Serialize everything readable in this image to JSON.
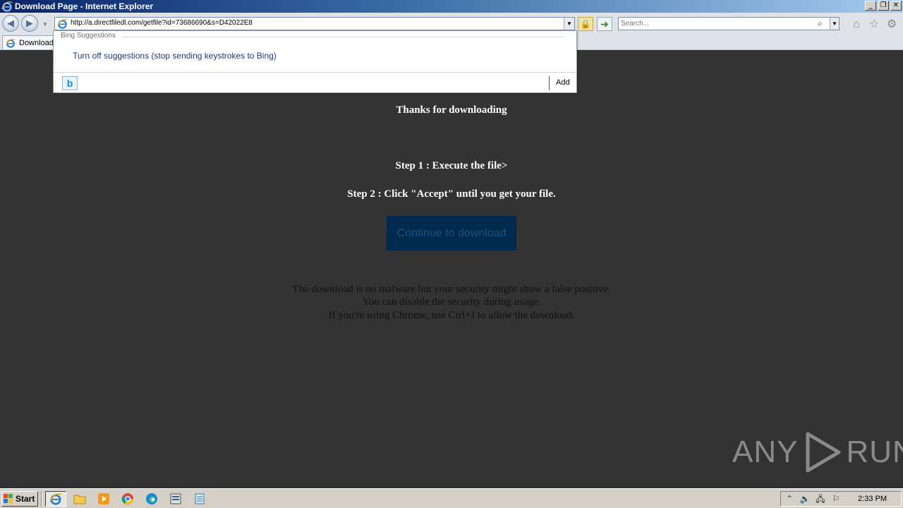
{
  "window": {
    "title": "Download Page - Internet Explorer",
    "minimize": "_",
    "restore": "❐",
    "close": "✕"
  },
  "toolbar": {
    "url": "http://a.directfiledl.com/getfile?id=73686690&s=D42022E8",
    "search_placeholder": "Search..."
  },
  "tabs": [
    {
      "label": "Download"
    }
  ],
  "suggestions": {
    "header": "Bing Suggestions",
    "item": "Turn off suggestions (stop sending keystrokes to Bing)",
    "add_label": "Add"
  },
  "page": {
    "heading": "Thanks for downloading",
    "step1": "Step 1 : Execute the file>",
    "step2": "Step 2 : Click \"Accept\" until you get your file.",
    "button_label": "Continue to download",
    "note_line1": "The download is no malware but your security might show a false positive.",
    "note_line2": "You can disable the security during usage.",
    "note_line3": "If you're using Chrome, use Ctrl+J to allow the download."
  },
  "watermark": {
    "left": "ANY",
    "right": "RUN"
  },
  "taskbar": {
    "start_label": "Start",
    "clock": "2:33 PM",
    "apps": [
      "ie-icon",
      "folder-icon",
      "media-player-icon",
      "chrome-icon",
      "edge-icon",
      "program-icon",
      "notepad-icon"
    ]
  },
  "colors": {
    "page_background": "#333333",
    "button_background": "#002a4d",
    "button_text": "#1d5280"
  }
}
